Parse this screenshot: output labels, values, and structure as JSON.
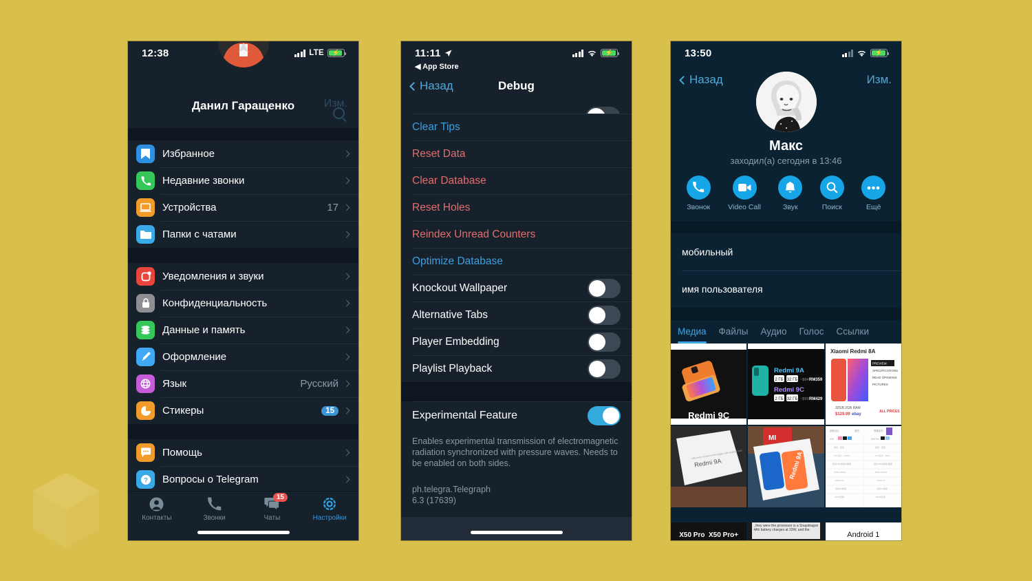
{
  "background": {
    "color": "#d9bf4c",
    "watermark": "cube-logo"
  },
  "phone1": {
    "status": {
      "time": "12:38",
      "network": "LTE",
      "battery_charging": true
    },
    "header": {
      "title": "Данил Гаращенко",
      "edit_label": "Изм.",
      "search_icon": "search-icon"
    },
    "groups": [
      {
        "items": [
          {
            "label": "Избранное",
            "icon": "bookmark-icon",
            "icon_color": "#2f8fe0",
            "value": "",
            "badge": ""
          },
          {
            "label": "Недавние звонки",
            "icon": "phone-icon",
            "icon_color": "#35c759",
            "value": "",
            "badge": ""
          },
          {
            "label": "Устройства",
            "icon": "laptop-icon",
            "icon_color": "#f19c2a",
            "value": "17",
            "badge": ""
          },
          {
            "label": "Папки с чатами",
            "icon": "folder-icon",
            "icon_color": "#39a9e8",
            "value": "",
            "badge": ""
          }
        ]
      },
      {
        "items": [
          {
            "label": "Уведомления и звуки",
            "icon": "bell-notification-icon",
            "icon_color": "#e8453c",
            "value": "",
            "badge": ""
          },
          {
            "label": "Конфиденциальность",
            "icon": "lock-icon",
            "icon_color": "#8e8e93",
            "value": "",
            "badge": ""
          },
          {
            "label": "Данные и память",
            "icon": "database-icon",
            "icon_color": "#35c759",
            "value": "",
            "badge": ""
          },
          {
            "label": "Оформление",
            "icon": "paintbrush-icon",
            "icon_color": "#3fa9f5",
            "value": "",
            "badge": ""
          },
          {
            "label": "Язык",
            "icon": "globe-icon",
            "icon_color": "#c45cd8",
            "value": "Русский",
            "badge": ""
          },
          {
            "label": "Стикеры",
            "icon": "sticker-icon",
            "icon_color": "#f19c2a",
            "value": "",
            "badge": "15"
          }
        ]
      },
      {
        "items": [
          {
            "label": "Помощь",
            "icon": "chat-bubble-icon",
            "icon_color": "#f19c2a",
            "value": "",
            "badge": ""
          },
          {
            "label": "Вопросы о Telegram",
            "icon": "question-mark-icon",
            "icon_color": "#39a9e8",
            "value": "",
            "badge": ""
          }
        ]
      }
    ],
    "tabbar": [
      {
        "label": "Контакты",
        "icon": "person-icon",
        "badge": "",
        "active": false
      },
      {
        "label": "Звонки",
        "icon": "phone-icon",
        "badge": "",
        "active": false
      },
      {
        "label": "Чаты",
        "icon": "chats-icon",
        "badge": "15",
        "active": false
      },
      {
        "label": "Настройки",
        "icon": "gear-icon",
        "badge": "",
        "active": true
      }
    ]
  },
  "phone2": {
    "status": {
      "time": "11:11",
      "location_arrow": true,
      "back_app": "App Store",
      "battery_charging": true
    },
    "nav": {
      "back_label": "Назад",
      "title": "Debug"
    },
    "rows": [
      {
        "label": "Clear Tips",
        "style": "blue",
        "control": "none"
      },
      {
        "label": "Reset Data",
        "style": "red",
        "control": "none"
      },
      {
        "label": "Clear Database",
        "style": "red",
        "control": "none"
      },
      {
        "label": "Reset Holes",
        "style": "red",
        "control": "none"
      },
      {
        "label": "Reindex Unread Counters",
        "style": "red",
        "control": "none"
      },
      {
        "label": "Optimize Database",
        "style": "blue",
        "control": "none"
      },
      {
        "label": "Knockout Wallpaper",
        "style": "white",
        "control": "toggle",
        "on": false
      },
      {
        "label": "Alternative Tabs",
        "style": "white",
        "control": "toggle",
        "on": false
      },
      {
        "label": "Player Embedding",
        "style": "white",
        "control": "toggle",
        "on": false
      },
      {
        "label": "Playlist Playback",
        "style": "white",
        "control": "toggle",
        "on": false
      }
    ],
    "experimental": {
      "label": "Experimental Feature",
      "on": true
    },
    "footer_text": "Enables experimental transmission of electromagnetic radiation synchronized with pressure waves. Needs to be enabled on both sides.",
    "bundle_id": "ph.telegra.Telegraph",
    "version": "6.3 (17639)"
  },
  "phone3": {
    "status": {
      "time": "13:50",
      "battery_charging": true
    },
    "nav": {
      "back_label": "Назад",
      "edit_label": "Изм."
    },
    "profile": {
      "name": "Макс",
      "status": "заходил(а) сегодня в 13:46",
      "avatar": "user-avatar"
    },
    "actions": [
      {
        "label": "Звонок",
        "icon": "phone-icon"
      },
      {
        "label": "Video Call",
        "icon": "video-camera-icon"
      },
      {
        "label": "Звук",
        "icon": "bell-icon"
      },
      {
        "label": "Поиск",
        "icon": "search-icon"
      },
      {
        "label": "Ещё",
        "icon": "ellipsis-icon"
      }
    ],
    "info_rows": [
      {
        "label": "мобильный"
      },
      {
        "label": "имя пользователя"
      }
    ],
    "tabs": [
      {
        "label": "Медиа",
        "active": true
      },
      {
        "label": "Файлы",
        "active": false
      },
      {
        "label": "Аудио",
        "active": false
      },
      {
        "label": "Голос",
        "active": false
      },
      {
        "label": "Ссылки",
        "active": false
      }
    ],
    "media": [
      {
        "caption": "Redmi 9C",
        "kind": "phone-photo-dark"
      },
      {
        "caption": "",
        "kind": "price-comparison"
      },
      {
        "caption": "",
        "kind": "product-page"
      },
      {
        "caption": "",
        "kind": "box-photo"
      },
      {
        "caption": "",
        "kind": "box-photo-blue"
      },
      {
        "caption": "",
        "kind": "spec-table"
      }
    ]
  }
}
